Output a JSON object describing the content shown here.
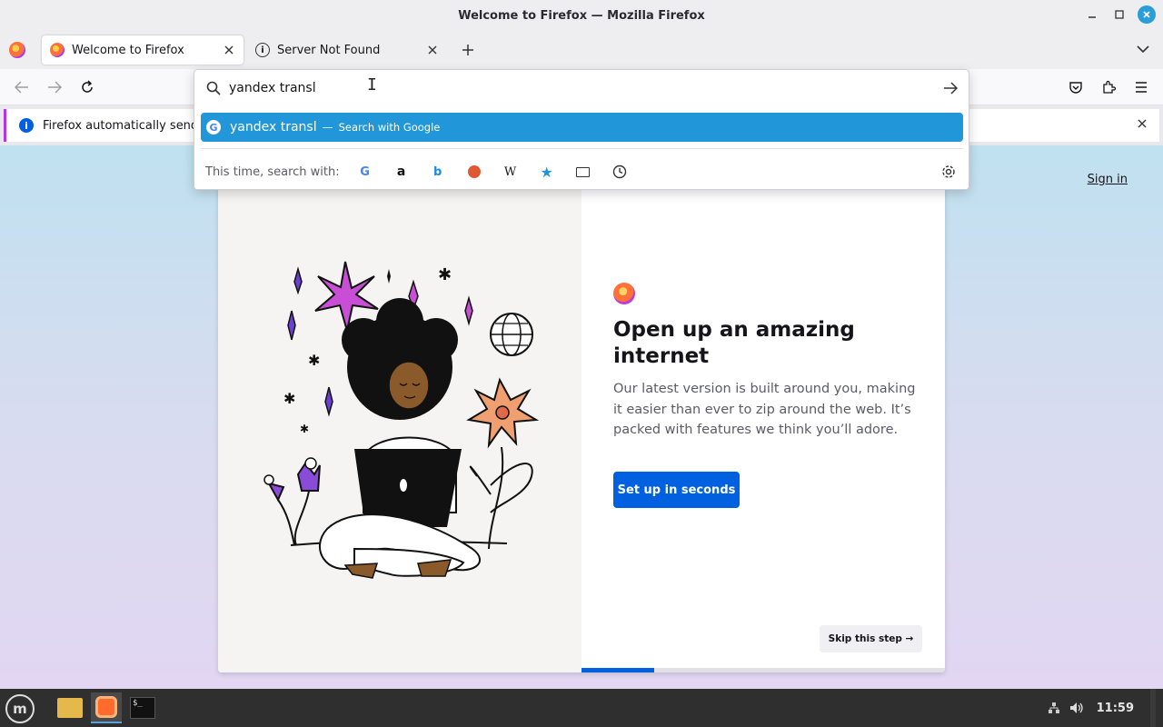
{
  "window": {
    "title": "Welcome to Firefox — Mozilla Firefox"
  },
  "tabs": [
    {
      "label": "Welcome to Firefox"
    },
    {
      "label": "Server Not Found"
    }
  ],
  "urlbar": {
    "value": "yandex transl",
    "suggestion_text": "yandex transl",
    "suggestion_dash": "—",
    "suggestion_action": "Search with Google",
    "oneoff_label": "This time, search with:",
    "engines": [
      "google-icon",
      "amazon-icon",
      "bing-icon",
      "duckduckgo-icon",
      "wikipedia-icon",
      "bookmarks-icon",
      "tabs-icon",
      "history-icon"
    ]
  },
  "notification": {
    "text": "Firefox automatically sends"
  },
  "page": {
    "signin": "Sign in",
    "headline": "Open up an amazing internet",
    "subtext": "Our latest version is built around you, making it easier than ever to zip around the web. It’s packed with features we think you’ll adore.",
    "cta": "Set up in seconds",
    "skip": "Skip this step →",
    "progress": 0.2
  },
  "taskbar": {
    "clock": "11:59"
  },
  "colors": {
    "accent": "#0061e0",
    "highlight": "#2196d9"
  }
}
